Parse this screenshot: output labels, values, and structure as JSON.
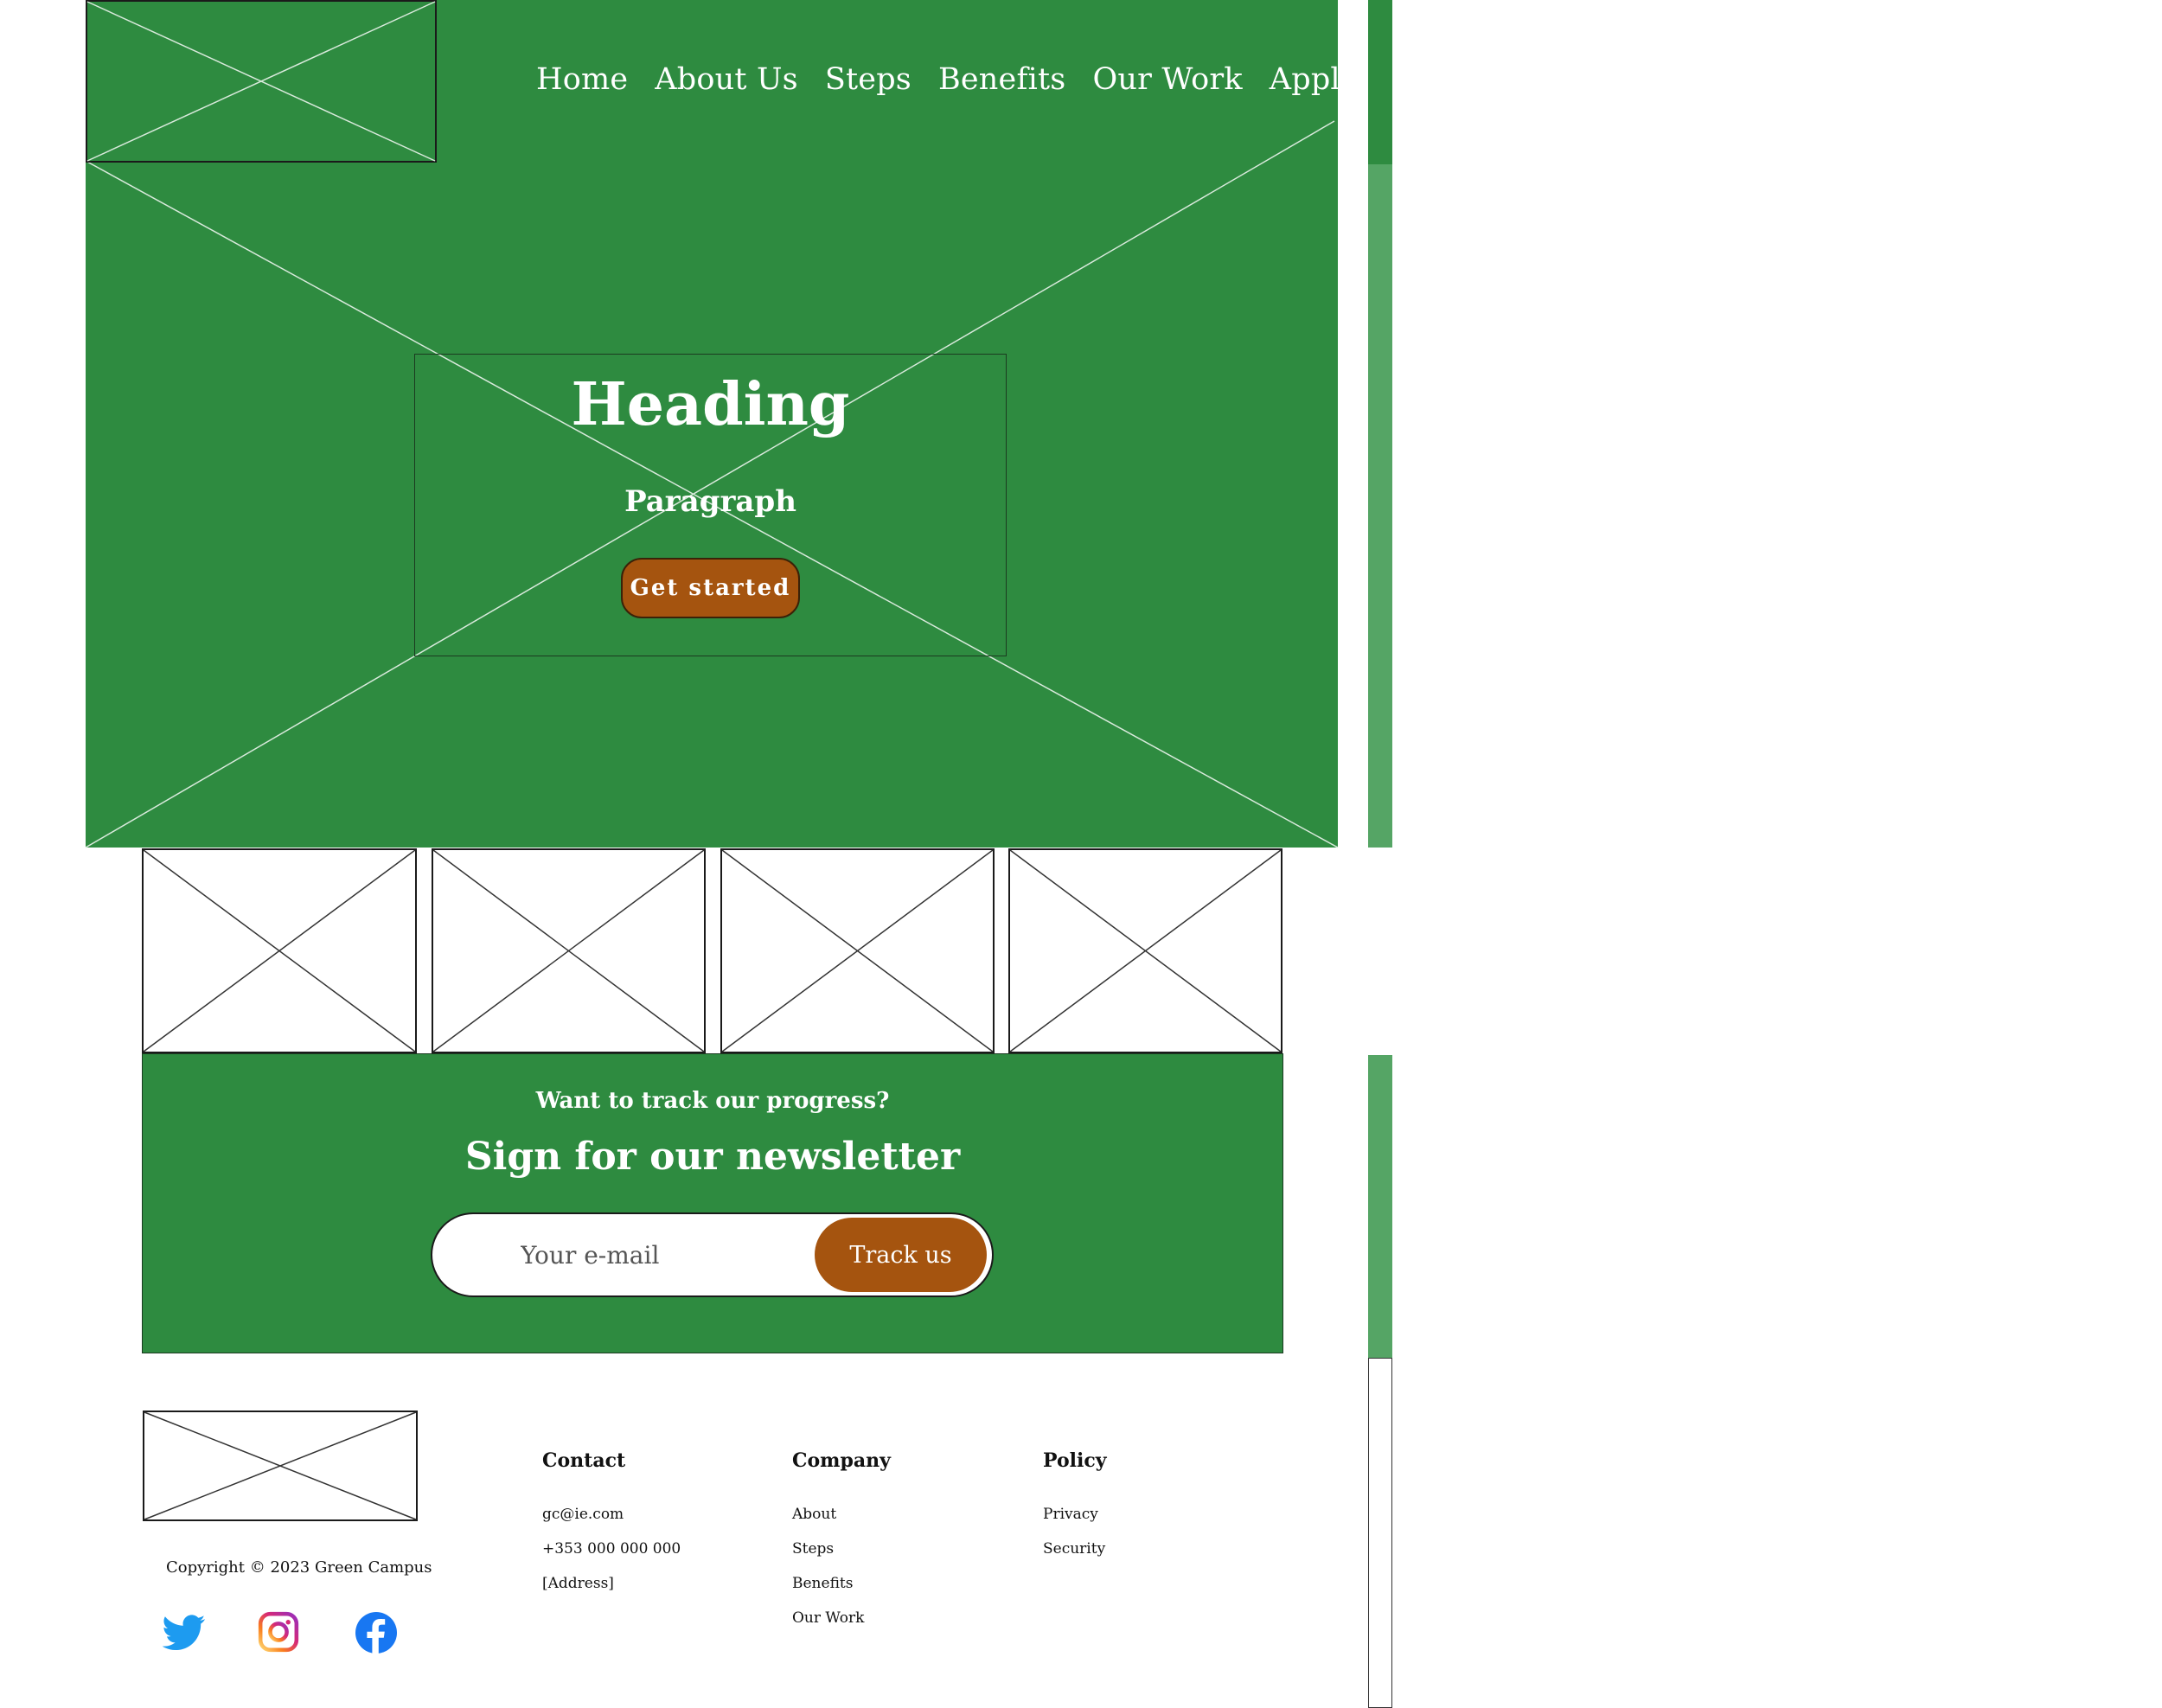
{
  "nav": {
    "items": [
      "Home",
      "About Us",
      "Steps",
      "Benefits",
      "Our Work",
      "Apply"
    ]
  },
  "hero": {
    "heading": "Heading",
    "paragraph": "Paragraph",
    "cta_label": "Get started"
  },
  "newsletter": {
    "question": "Want to track our progress?",
    "title": "Sign for our newsletter",
    "email_placeholder": "Your e-mail",
    "submit_label": "Track us"
  },
  "footer": {
    "copyright": "Copyright © 2023 Green Campus",
    "columns": [
      {
        "heading": "Contact",
        "items": [
          "gc@ie.com",
          "+353 000 000 000",
          "[Address]"
        ]
      },
      {
        "heading": "Company",
        "items": [
          "About",
          "Steps",
          "Benefits",
          "Our Work"
        ]
      },
      {
        "heading": "Policy",
        "items": [
          "Privacy",
          "Security"
        ]
      }
    ],
    "social": [
      "twitter-icon",
      "instagram-icon",
      "facebook-icon"
    ]
  },
  "colors": {
    "primary_green": "#2e8b40",
    "light_green": "#55a565",
    "accent_orange": "#a5540f",
    "twitter_blue": "#1d9bf0",
    "facebook_blue": "#1877f2"
  }
}
